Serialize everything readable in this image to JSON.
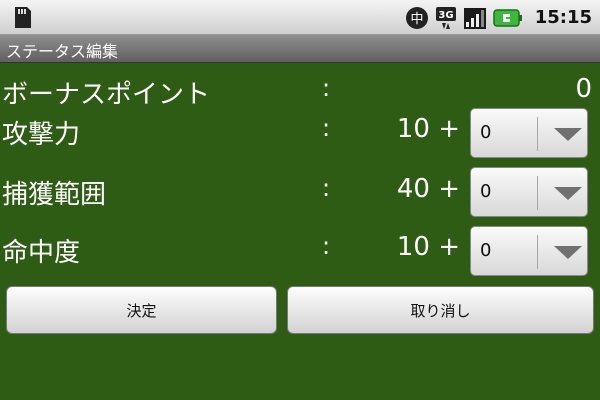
{
  "status_bar": {
    "icons": [
      "sd-card-icon",
      "chinese-input-icon",
      "3g-signal-icon",
      "signal-bars-icon",
      "battery-icon"
    ],
    "input_indicator": "中",
    "network": "3G",
    "time": "15:15"
  },
  "title_bar": {
    "title": "ステータス編集"
  },
  "rows": [
    {
      "label": "ボーナスポイント",
      "colon": ":",
      "value": "0"
    },
    {
      "label": "攻撃力",
      "colon": ":",
      "value": "10 +",
      "select_value": "0"
    },
    {
      "label": "捕獲範囲",
      "colon": ":",
      "value": "40 +",
      "select_value": "0"
    },
    {
      "label": "命中度",
      "colon": ":",
      "value": "10 +",
      "select_value": "0"
    }
  ],
  "buttons": {
    "confirm": "決定",
    "cancel": "取り消し"
  },
  "colors": {
    "background": "#2e5c14",
    "battery": "#3db83d"
  }
}
